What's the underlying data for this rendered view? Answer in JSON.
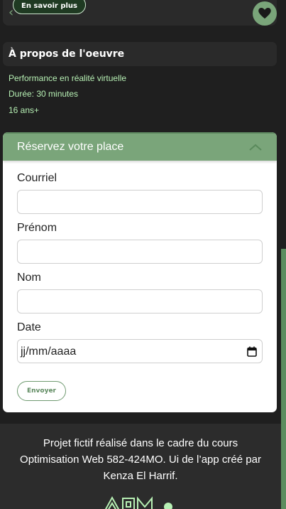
{
  "top_card": {
    "more_label": "En savoir plus"
  },
  "about": {
    "title": "À propos de l'oeuvre",
    "lines": [
      "Performance en réalité virtuelle",
      "Durée: 30 minutes",
      "16 ans+"
    ]
  },
  "form": {
    "title": "Réservez votre place",
    "email_label": "Courriel",
    "firstname_label": "Prénom",
    "lastname_label": "Nom",
    "date_label": "Date",
    "date_placeholder": "jj/mm/aaaa",
    "submit_label": "Envoyer"
  },
  "footer": {
    "lines": [
      "Projet fictif réalisé dans le cadre du cours",
      "Optimisation Web 582-424MO. Ui de l’app créé par",
      "Kenza El Harrif."
    ]
  },
  "icons": {
    "back": "chevron-left-icon",
    "favorite": "heart-icon",
    "collapse": "chevron-up-icon",
    "calendar": "calendar-icon",
    "logo": "logo-icon"
  },
  "colors": {
    "accent": "#7aa57a",
    "accent_dark": "#5c8d5f",
    "info_text": "#b7f0b4",
    "background": "#1f1f1f",
    "card": "#2a2a2a"
  }
}
